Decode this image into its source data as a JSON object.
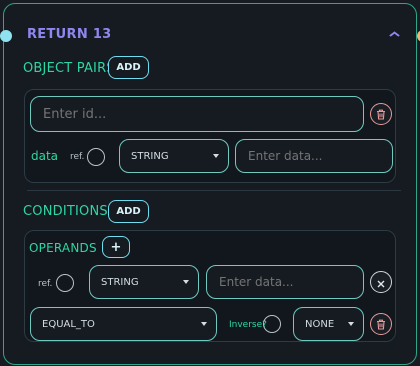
{
  "node": {
    "title": "RETURN 13",
    "collapse_icon": "chevron-up-icon",
    "accent_color": "#2fa68a",
    "title_color": "#8f86ef"
  },
  "object_pairs": {
    "label": "OBJECT PAIRS",
    "add_label": "ADD",
    "id_placeholder": "Enter id...",
    "data_label": "data",
    "ref_label": "ref.",
    "type_value": "STRING",
    "data_placeholder": "Enter data..."
  },
  "conditions": {
    "label": "CONDITIONS",
    "add_label": "ADD",
    "operands": {
      "label": "OPERANDS",
      "add_label": "+",
      "ref_label": "ref.",
      "type_value": "STRING",
      "data_placeholder": "Enter data..."
    },
    "operator_value": "EQUAL_TO",
    "inverse_label": "Inverse?",
    "modifier_value": "NONE"
  }
}
